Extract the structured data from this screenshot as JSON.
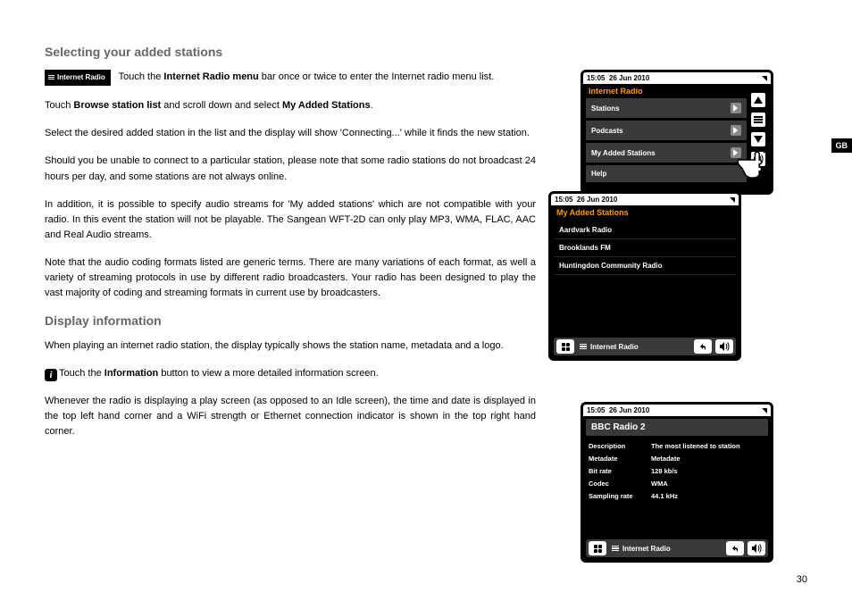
{
  "lang_tab": "GB",
  "page_number": "30",
  "section1_heading": "Selecting your added stations",
  "tag_label": "Internet Radio",
  "p1a": "Touch the ",
  "p1b": "Internet Radio menu",
  "p1c": " bar once or twice to enter the Internet radio menu list.",
  "p2a": "Touch ",
  "p2b": "Browse station list",
  "p2c": " and scroll down and select ",
  "p2d": "My Added Stations",
  "p2e": ".",
  "p3": "Select the desired added station in the list and the display will show 'Connecting...' while it finds the new station.",
  "p4": "Should you be unable to connect to a particular station, please note that some radio stations do not broadcast 24 hours per day, and some stations are not always online.",
  "p5": "In addition, it is possible to specify audio streams for 'My added stations' which are not compatible with your radio. In this event the station will not be playable. The Sangean WFT-2D can only play MP3, WMA, FLAC, AAC and Real Audio streams.",
  "p6": "Note that the audio coding formats listed are generic terms. There are many variations of each format, as well a variety of streaming protocols in use by different radio broadcasters. Your radio has been designed to play the vast majority of coding and streaming formats in current use by broadcasters.",
  "section2_heading": "Display information",
  "p7": "When playing an internet radio station, the display typically shows the station name, metadata and a logo.",
  "p8a": "Touch the ",
  "p8b": "Information",
  "p8c": " button to view a more detailed information screen.",
  "p9": "Whenever the radio is displaying a play screen (as opposed to an Idle screen), the time and date is displayed in the top left hand corner and a WiFi strength or Ethernet connection indicator is shown in the top right hand corner.",
  "screen1": {
    "time": "15:05",
    "date": "26 Jun 2010",
    "title": "Internet Radio",
    "items": [
      "Stations",
      "Podcasts",
      "My Added Stations",
      "Help"
    ]
  },
  "screen2": {
    "time": "15:05",
    "date": "26 Jun 2010",
    "title": "My Added Stations",
    "items": [
      "Aardvark Radio",
      "Brooklands FM",
      "Huntingdon Community Radio"
    ],
    "footer": "Internet Radio"
  },
  "screen3": {
    "time": "15:05",
    "date": "26 Jun 2010",
    "station": "BBC Radio 2",
    "rows": [
      {
        "label": "Description",
        "value": "The most listened to station"
      },
      {
        "label": "Metadate",
        "value": "Metadate"
      },
      {
        "label": "Bit rate",
        "value": "128 kb/s"
      },
      {
        "label": "Codec",
        "value": "WMA"
      },
      {
        "label": "Sampling rate",
        "value": "44.1 kHz"
      }
    ],
    "footer": "Internet Radio"
  }
}
